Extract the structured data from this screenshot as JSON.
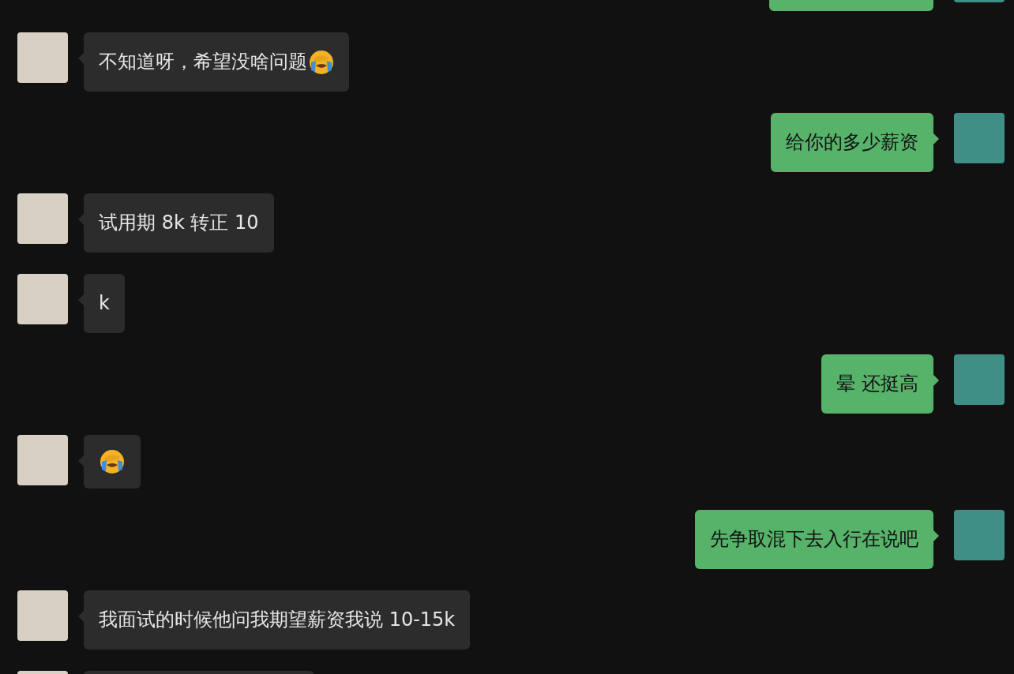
{
  "messages": [
    {
      "outgoing": true,
      "kind": "partial"
    },
    {
      "outgoing": false,
      "kind": "text",
      "text": "不知道呀，希望没啥问题",
      "emoji": true
    },
    {
      "outgoing": true,
      "kind": "text",
      "text": "给你的多少薪资",
      "emoji": false
    },
    {
      "outgoing": false,
      "kind": "text",
      "text": "试用期 8k 转正 10",
      "emoji": false
    },
    {
      "outgoing": false,
      "kind": "text",
      "text": "k",
      "emoji": false
    },
    {
      "outgoing": true,
      "kind": "text",
      "text": "晕 还挺高",
      "emoji": false
    },
    {
      "outgoing": false,
      "kind": "emoji"
    },
    {
      "outgoing": true,
      "kind": "text",
      "text": "先争取混下去入行在说吧",
      "emoji": false
    },
    {
      "outgoing": false,
      "kind": "text",
      "text": "我面试的时候他问我期望薪资我说 10-15k",
      "emoji": false
    },
    {
      "outgoing": false,
      "kind": "partial"
    }
  ]
}
